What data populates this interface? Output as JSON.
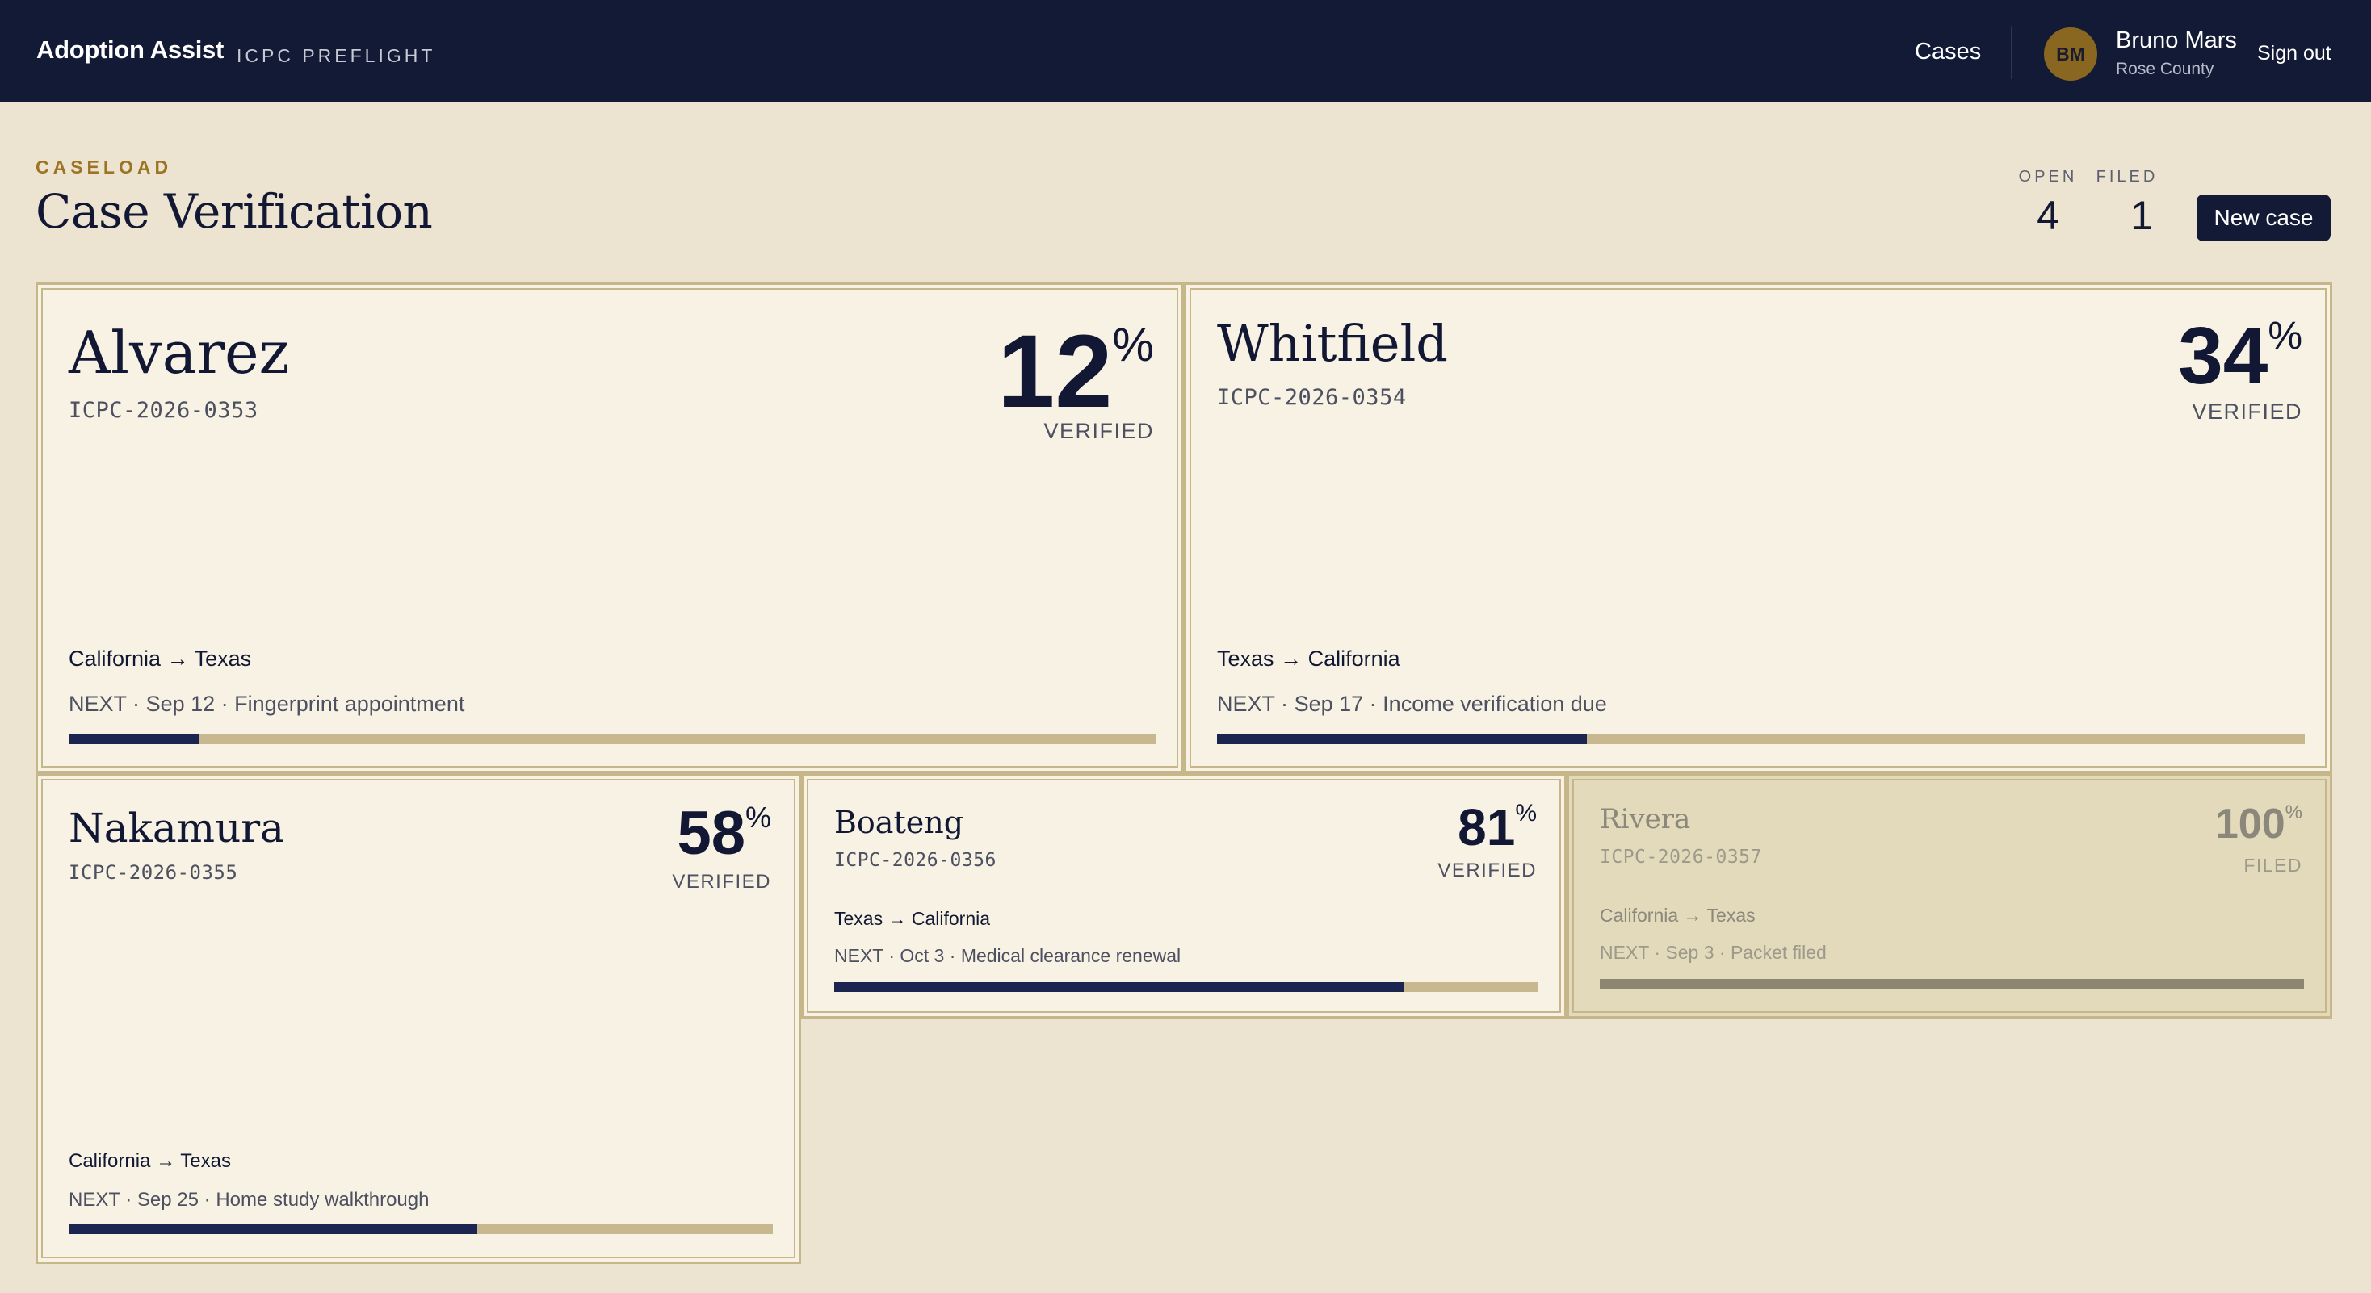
{
  "app": {
    "brand": "Adoption Assist",
    "product": "ICPC PREFLIGHT"
  },
  "nav": {
    "cases": "Cases",
    "signout": "Sign out"
  },
  "user": {
    "initials": "BM",
    "name": "Bruno Mars",
    "county": "Rose County"
  },
  "header": {
    "eyebrow": "CASELOAD",
    "title": "Case Verification",
    "new_case_label": "New case"
  },
  "stats": {
    "open_label": "OPEN",
    "open_value": "4",
    "filed_label": "FILED",
    "filed_value": "1"
  },
  "colors": {
    "navy": "#131a36",
    "accent_gold": "#9c7424",
    "avatar": "#8a6720",
    "progress_fill": "#1b2550",
    "progress_track": "#c8b88f",
    "background": "#ece4d0",
    "card": "#f7f2e4"
  },
  "cases": [
    {
      "name": "Alvarez",
      "id": "ICPC-2026-0353",
      "percent": "12",
      "percent_sign": "%",
      "status": "VERIFIED",
      "from": "California",
      "arrow": "→",
      "to": "Texas",
      "next_label": "NEXT",
      "next_date": "Sep 12",
      "next_task": "Fingerprint appointment",
      "sep": "·",
      "progress": 0.12
    },
    {
      "name": "Whitfield",
      "id": "ICPC-2026-0354",
      "percent": "34",
      "percent_sign": "%",
      "status": "VERIFIED",
      "from": "Texas",
      "arrow": "→",
      "to": "California",
      "next_label": "NEXT",
      "next_date": "Sep 17",
      "next_task": "Income verification due",
      "sep": "·",
      "progress": 0.34
    },
    {
      "name": "Nakamura",
      "id": "ICPC-2026-0355",
      "percent": "58",
      "percent_sign": "%",
      "status": "VERIFIED",
      "from": "California",
      "arrow": "→",
      "to": "Texas",
      "next_label": "NEXT",
      "next_date": "Sep 25",
      "next_task": "Home study walkthrough",
      "sep": "·",
      "progress": 0.58
    },
    {
      "name": "Boateng",
      "id": "ICPC-2026-0356",
      "percent": "81",
      "percent_sign": "%",
      "status": "VERIFIED",
      "from": "Texas",
      "arrow": "→",
      "to": "California",
      "next_label": "NEXT",
      "next_date": "Oct 3",
      "next_task": "Medical clearance renewal",
      "sep": "·",
      "progress": 0.81
    },
    {
      "name": "Rivera",
      "id": "ICPC-2026-0357",
      "percent": "100",
      "percent_sign": "%",
      "status": "FILED",
      "from": "California",
      "arrow": "→",
      "to": "Texas",
      "next_label": "NEXT",
      "next_date": "Sep 3",
      "next_task": "Packet filed",
      "sep": "·",
      "progress": 1.0
    }
  ]
}
